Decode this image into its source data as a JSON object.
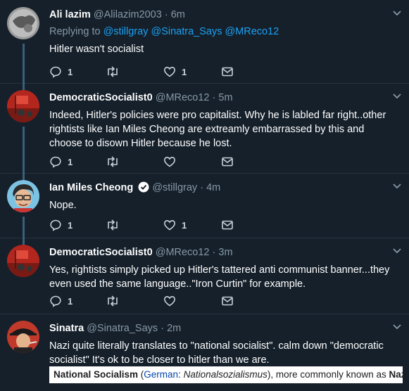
{
  "tweets": [
    {
      "name": "Ali lazim",
      "handle": "@Alilazim2003",
      "time": "6m",
      "reply_prefix": "Replying to",
      "reply_mentions": "@stillgray @Sinatra_Says @MReco12",
      "text": "Hitler wasn't socialist",
      "reply_count": "1",
      "like_count": "1"
    },
    {
      "name": "DemocraticSocialist0",
      "handle": "@MReco12",
      "time": "5m",
      "text": "Indeed, Hitler's policies were pro capitalist. Why he is labled far right..other rightists like Ian Miles Cheong are extreamly embarrassed by this and choose to disown Hitler because he lost.",
      "reply_count": "1",
      "like_count": ""
    },
    {
      "name": "Ian Miles Cheong",
      "handle": "@stillgray",
      "time": "4m",
      "text": "Nope.",
      "reply_count": "1",
      "like_count": "1"
    },
    {
      "name": "DemocraticSocialist0",
      "handle": "@MReco12",
      "time": "3m",
      "text": "Yes, rightists simply picked up Hitler's tattered anti communist banner...they even used the same language..\"Iron Curtin\" for example.",
      "reply_count": "1",
      "like_count": ""
    },
    {
      "name": "Sinatra",
      "handle": "@Sinatra_Says",
      "time": "2m",
      "text": "Nazi quite literally translates to \"national socialist\". calm down \"democratic socialist\" It's ok to be closer to hitler than we are."
    }
  ],
  "separator": "·",
  "wiki_snippet": {
    "term": "National Socialism",
    "open": " (",
    "lang": "German",
    "colon": ": ",
    "native": "Nationalsozialismus",
    "rest": "), more commonly known as ",
    "alias": "Nazism"
  },
  "colors": {
    "background": "#15202b",
    "muted": "#8899a6",
    "accent": "#1da1f2",
    "thread_line": "#3b5e79"
  },
  "icons": [
    "reply-icon",
    "retweet-icon",
    "like-icon",
    "message-icon",
    "chevron-down-icon",
    "verified-icon"
  ]
}
